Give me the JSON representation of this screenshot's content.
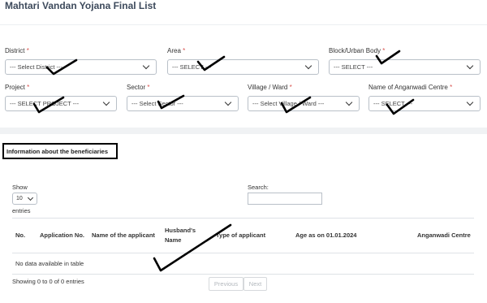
{
  "page": {
    "title": "Mahtari Vandan Yojana Final List"
  },
  "filters": [
    {
      "label": "District",
      "required": "*",
      "value": "--- Select District ---"
    },
    {
      "label": "Area",
      "required": "*",
      "value": "--- SELECT ---"
    },
    {
      "label": "Block/Urban Body",
      "required": "*",
      "value": "--- SELECT ---"
    },
    {
      "label": "Project",
      "required": "*",
      "value": "--- SELECT PROJECT ---"
    },
    {
      "label": "Sector",
      "required": "*",
      "value": "--- Select Sector ---"
    },
    {
      "label": "Village / Ward",
      "required": "*",
      "value": "--- Select Village / Ward ---"
    },
    {
      "label": "Name of Anganwadi Centre",
      "required": "*",
      "value": "--- SELECT ---"
    }
  ],
  "section": {
    "heading": "Information about the beneficiaries"
  },
  "table_controls": {
    "show_label": "Show",
    "length_value": "10",
    "entries_label": "entries",
    "search_label": "Search:"
  },
  "table": {
    "headers": [
      "No.",
      "Application No.",
      "Name of the applicant",
      "Husband's Name",
      "Type of applicant",
      "Age as on 01.01.2024",
      "Anganwadi Centre"
    ],
    "empty_message": "No data available in table"
  },
  "footer": {
    "info": "Showing 0 to 0 of 0 entries",
    "previous": "Previous",
    "next": "Next"
  }
}
